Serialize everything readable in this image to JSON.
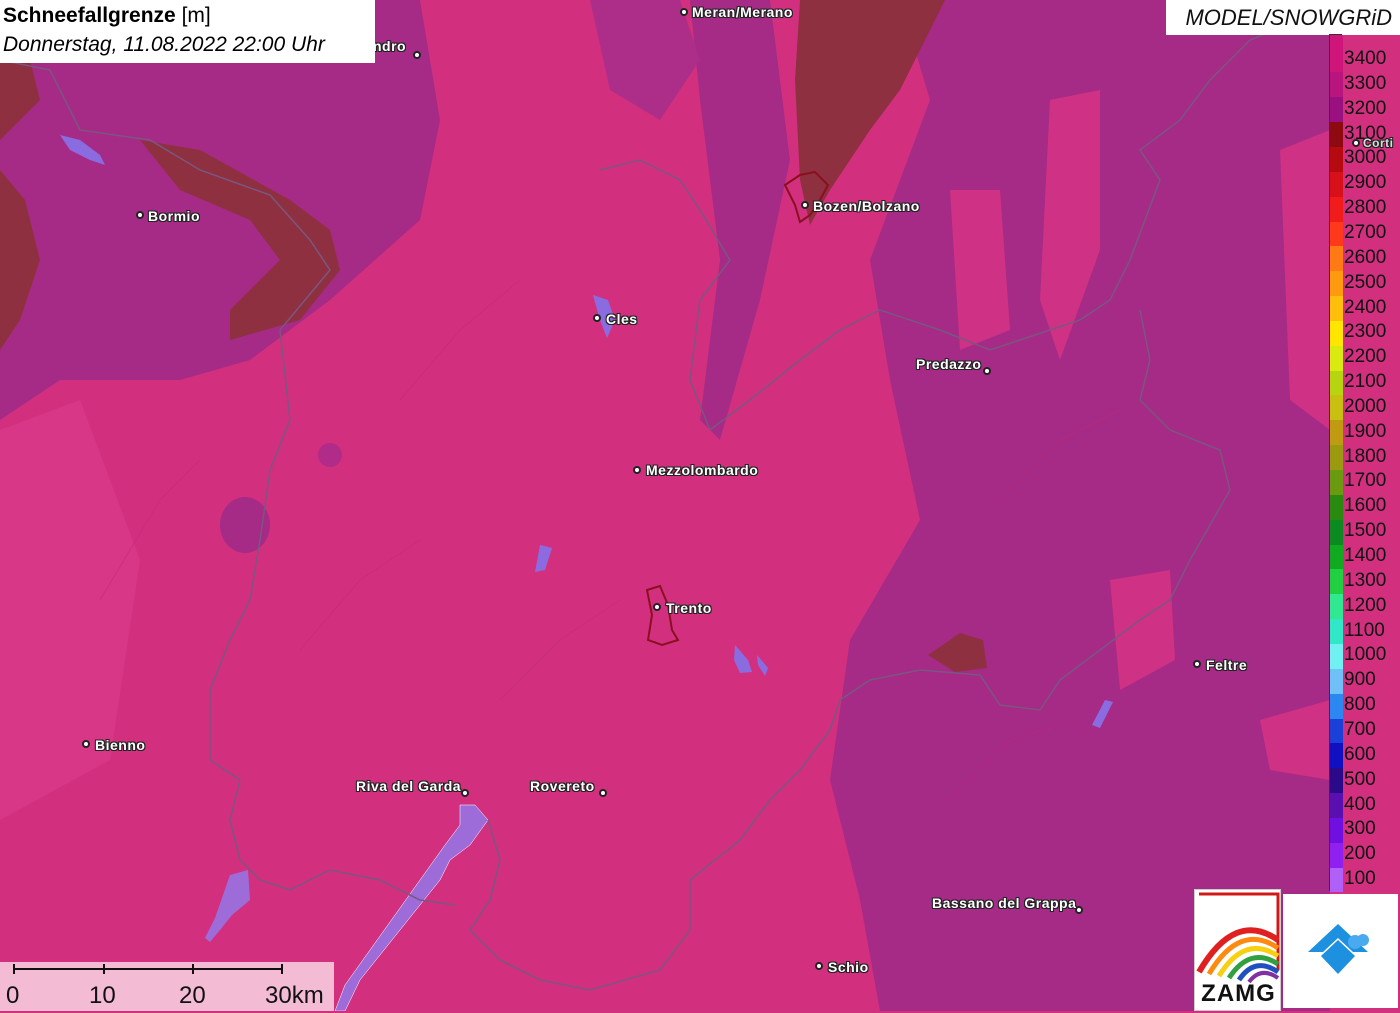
{
  "header": {
    "title_bold": "Schneefallgrenze",
    "title_unit": "[m]",
    "datetime": "Donnerstag, 11.08.2022 22:00 Uhr"
  },
  "model_label": "MODEL/SNOWGRiD",
  "legend": {
    "entries": [
      {
        "label": "3400",
        "color": "#d0157a"
      },
      {
        "label": "3300",
        "color": "#b8167e"
      },
      {
        "label": "3200",
        "color": "#9a1080"
      },
      {
        "label": "3100",
        "color": "#8c0a10"
      },
      {
        "label": "3000",
        "color": "#b50a10"
      },
      {
        "label": "2900",
        "color": "#d8101a"
      },
      {
        "label": "2800",
        "color": "#f01c1c"
      },
      {
        "label": "2700",
        "color": "#ff3a1a"
      },
      {
        "label": "2600",
        "color": "#ff7a14"
      },
      {
        "label": "2500",
        "color": "#ff9a10"
      },
      {
        "label": "2400",
        "color": "#ffbe0c"
      },
      {
        "label": "2300",
        "color": "#ffe600"
      },
      {
        "label": "2200",
        "color": "#d8ea10"
      },
      {
        "label": "2100",
        "color": "#b6d410"
      },
      {
        "label": "2000",
        "color": "#c8c010"
      },
      {
        "label": "1900",
        "color": "#c09a10"
      },
      {
        "label": "1800",
        "color": "#9a9a10"
      },
      {
        "label": "1700",
        "color": "#6a9a10"
      },
      {
        "label": "1600",
        "color": "#2a8a10"
      },
      {
        "label": "1500",
        "color": "#0a8a20"
      },
      {
        "label": "1400",
        "color": "#10aa20"
      },
      {
        "label": "1300",
        "color": "#20d040"
      },
      {
        "label": "1200",
        "color": "#30e890"
      },
      {
        "label": "1100",
        "color": "#30e8c8"
      },
      {
        "label": "1000",
        "color": "#70f0f0"
      },
      {
        "label": "900",
        "color": "#70c0f8"
      },
      {
        "label": "800",
        "color": "#2a88f0"
      },
      {
        "label": "700",
        "color": "#1a40d8"
      },
      {
        "label": "600",
        "color": "#1010c0"
      },
      {
        "label": "500",
        "color": "#2a0a88"
      },
      {
        "label": "400",
        "color": "#5a10b0"
      },
      {
        "label": "300",
        "color": "#7010e0"
      },
      {
        "label": "200",
        "color": "#9020f0"
      },
      {
        "label": "100",
        "color": "#b060f8"
      }
    ],
    "top_partial_color": "#d0157a"
  },
  "scale": {
    "labels": [
      "0",
      "10",
      "20",
      "30km"
    ]
  },
  "cities": [
    {
      "name": "Meran/Merano"
    },
    {
      "name": "ndro"
    },
    {
      "name": "Bormio"
    },
    {
      "name": "Bozen/Bolzano"
    },
    {
      "name": "Cles"
    },
    {
      "name": "Predazzo"
    },
    {
      "name": "Mezzolombardo"
    },
    {
      "name": "Trento"
    },
    {
      "name": "Feltre"
    },
    {
      "name": "Bienno"
    },
    {
      "name": "Riva del Garda"
    },
    {
      "name": "Rovereto"
    },
    {
      "name": "Bassano del Grappa"
    },
    {
      "name": "Schio"
    },
    {
      "name": "Corti"
    }
  ],
  "logos": {
    "zamg_text": "ZAMG"
  }
}
